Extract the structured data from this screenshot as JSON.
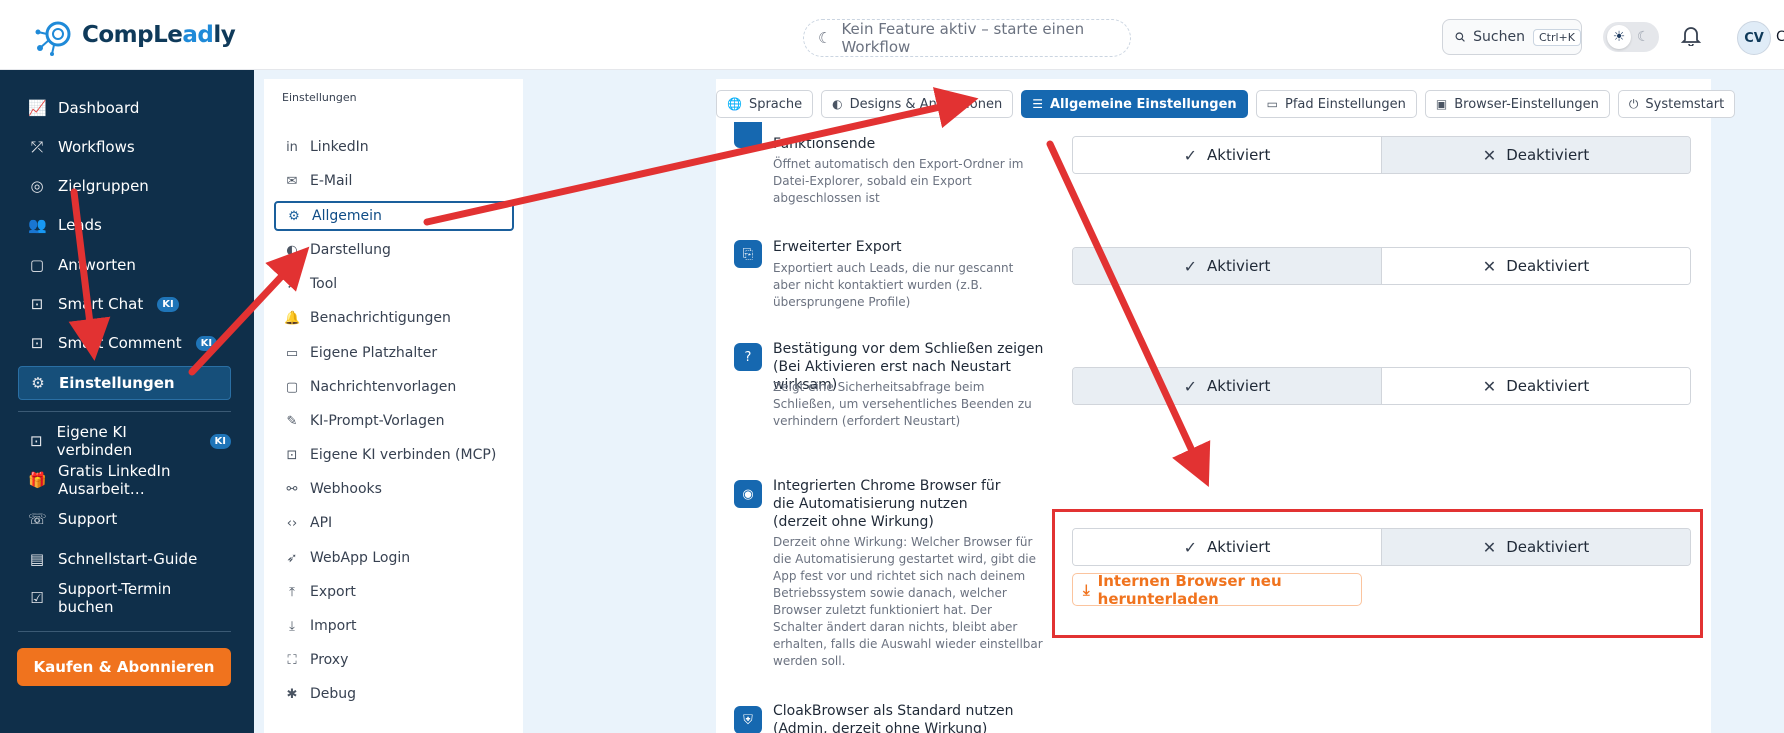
{
  "app": {
    "logo_text_main": "CompLe",
    "logo_text_accent": "ad",
    "logo_text_end": "ly"
  },
  "header": {
    "feature_status": "Kein Feature aktiv – starte einen Workflow",
    "search_label": "Suchen",
    "search_shortcut": "Ctrl+K",
    "avatar_initials": "CV",
    "avatar_extra": "C"
  },
  "sidebar": {
    "items": [
      {
        "label": "Dashboard",
        "icon": "chart-icon"
      },
      {
        "label": "Workflows",
        "icon": "workflow-icon"
      },
      {
        "label": "Zielgruppen",
        "icon": "target-icon"
      },
      {
        "label": "Leads",
        "icon": "users-icon"
      },
      {
        "label": "Antworten",
        "icon": "message-icon"
      },
      {
        "label": "Smart Chat",
        "icon": "bot-icon",
        "badge": "KI"
      },
      {
        "label": "Smart Comment",
        "icon": "bot-icon",
        "badge": "KI"
      },
      {
        "label": "Einstellungen",
        "icon": "gear-icon",
        "active": true
      }
    ],
    "items2": [
      {
        "label": "Eigene KI verbinden",
        "icon": "bot-icon",
        "badge": "KI"
      },
      {
        "label": "Gratis LinkedIn Ausarbeit…",
        "icon": "gift-icon"
      },
      {
        "label": "Support",
        "icon": "support-icon"
      },
      {
        "label": "Schnellstart-Guide",
        "icon": "book-icon"
      },
      {
        "label": "Support-Termin buchen",
        "icon": "calendar-icon"
      }
    ],
    "buy_button": "Kaufen & Abonnieren"
  },
  "settings_menu": {
    "title": "Einstellungen",
    "items": [
      {
        "label": "LinkedIn",
        "icon": "linkedin-icon"
      },
      {
        "label": "E-Mail",
        "icon": "mail-icon"
      },
      {
        "label": "Allgemein",
        "icon": "gear-icon",
        "active": true
      },
      {
        "label": "Darstellung",
        "icon": "palette-icon"
      },
      {
        "label": "Tool",
        "icon": "tool-icon"
      },
      {
        "label": "Benachrichtigungen",
        "icon": "bell-icon"
      },
      {
        "label": "Eigene Platzhalter",
        "icon": "placeholder-icon"
      },
      {
        "label": "Nachrichtenvorlagen",
        "icon": "template-icon"
      },
      {
        "label": "KI-Prompt-Vorlagen",
        "icon": "wand-icon"
      },
      {
        "label": "Eigene KI verbinden (MCP)",
        "icon": "bot-icon"
      },
      {
        "label": "Webhooks",
        "icon": "webhook-icon"
      },
      {
        "label": "API",
        "icon": "code-icon"
      },
      {
        "label": "WebApp Login",
        "icon": "rocket-icon"
      },
      {
        "label": "Export",
        "icon": "export-icon"
      },
      {
        "label": "Import",
        "icon": "import-icon"
      },
      {
        "label": "Proxy",
        "icon": "network-icon"
      },
      {
        "label": "Debug",
        "icon": "bug-icon"
      }
    ]
  },
  "tabs": [
    {
      "label": "Sprache",
      "icon": "globe-icon"
    },
    {
      "label": "Designs & Animationen",
      "icon": "palette-icon"
    },
    {
      "label": "Allgemeine Einstellungen",
      "icon": "sliders-icon",
      "active": true
    },
    {
      "label": "Pfad Einstellungen",
      "icon": "folder-icon"
    },
    {
      "label": "Browser-Einstellungen",
      "icon": "browser-icon"
    },
    {
      "label": "Systemstart",
      "icon": "power-icon"
    }
  ],
  "settings": [
    {
      "title": "Funktionsende",
      "desc": "Öffnet automatisch den Export-Ordner im Datei-Explorer, sobald ein Export abgeschlossen ist",
      "selected": "off"
    },
    {
      "title": "Erweiterter Export",
      "desc": "Exportiert auch Leads, die nur gescannt aber nicht kontaktiert wurden (z.B. übersprungene Profile)",
      "selected": "on"
    },
    {
      "title": "Bestätigung vor dem Schließen zeigen (Bei Aktivieren erst nach Neustart wirksam)",
      "desc": "Zeigt eine Sicherheitsabfrage beim Schließen, um versehentliches Beenden zu verhindern (erfordert Neustart)",
      "selected": "on"
    },
    {
      "title": "Integrierten Chrome Browser für die Automatisierung nutzen (derzeit ohne Wirkung)",
      "desc": "Derzeit ohne Wirkung: Welcher Browser für die Automatisierung gestartet wird, gibt die App fest vor und richtet sich nach deinem Betriebssystem sowie danach, welcher Browser zuletzt funktioniert hat. Der Schalter ändert daran nichts, bleibt aber erhalten, falls die Auswahl wieder einstellbar werden soll.",
      "selected": "off"
    },
    {
      "title": "CloakBrowser als Standard nutzen (Admin, derzeit ohne Wirkung)",
      "desc": "",
      "selected": ""
    }
  ],
  "toggle_labels": {
    "on": "Aktiviert",
    "off": "Deaktiviert"
  },
  "redownload_button": "Internen Browser neu herunterladen",
  "colors": {
    "sidebar_bg": "#0f2f4a",
    "accent_blue": "#1668b0",
    "orange": "#f0731e",
    "annotation_red": "#e23232"
  }
}
